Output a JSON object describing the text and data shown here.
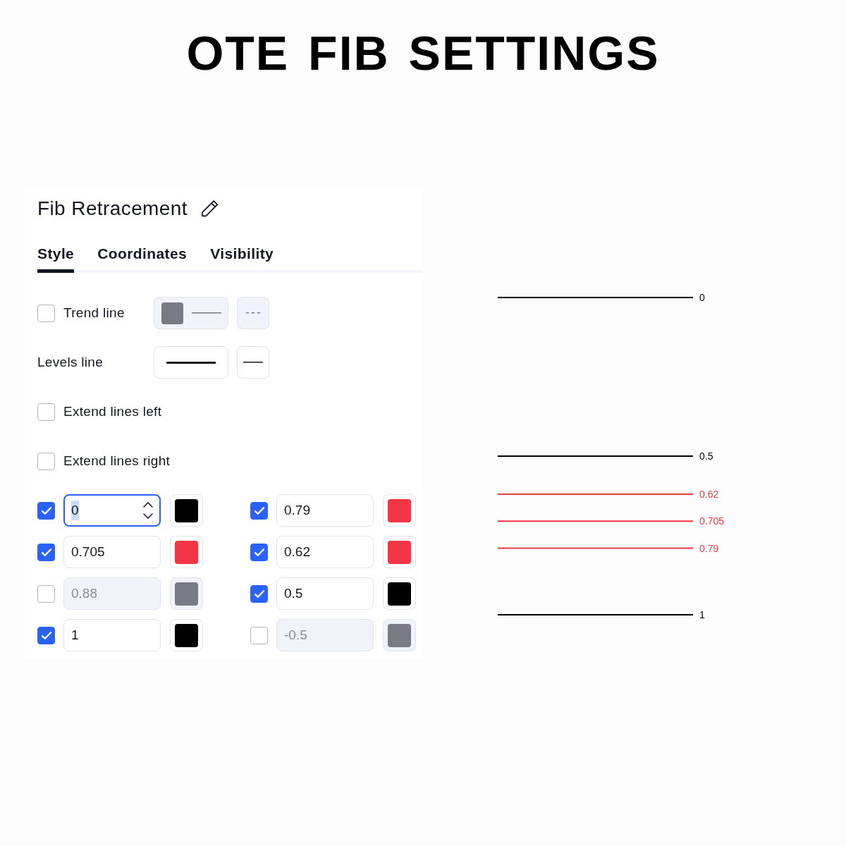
{
  "page_title": "OTE FIB SETTINGS",
  "settings": {
    "title": "Fib Retracement",
    "tabs": [
      {
        "label": "Style",
        "selected": true
      },
      {
        "label": "Coordinates",
        "selected": false
      },
      {
        "label": "Visibility",
        "selected": false
      }
    ],
    "rows": [
      {
        "kind": "line-toggle",
        "label": "Trend line",
        "checked": false
      },
      {
        "kind": "line",
        "label": "Levels line"
      },
      {
        "kind": "toggle",
        "label": "Extend lines left",
        "checked": false
      },
      {
        "kind": "toggle",
        "label": "Extend lines right",
        "checked": false
      }
    ],
    "levels": [
      {
        "value": "0",
        "checked": true,
        "focused": true,
        "color": "#000000"
      },
      {
        "value": "0.79",
        "checked": true,
        "focused": false,
        "color": "#f23645"
      },
      {
        "value": "0.705",
        "checked": true,
        "focused": false,
        "color": "#f23645"
      },
      {
        "value": "0.62",
        "checked": true,
        "focused": false,
        "color": "#f23645"
      },
      {
        "value": "0.88",
        "checked": false,
        "focused": false,
        "color": "#787b86"
      },
      {
        "value": "0.5",
        "checked": true,
        "focused": false,
        "color": "#000000"
      },
      {
        "value": "1",
        "checked": true,
        "focused": false,
        "color": "#000000"
      },
      {
        "value": "-0.5",
        "checked": false,
        "focused": false,
        "color": "#787b86"
      }
    ]
  },
  "preview": {
    "lines": [
      {
        "label": "0",
        "color": "#000000"
      },
      {
        "label": "0.5",
        "color": "#000000"
      },
      {
        "label": "0.62",
        "color": "#f23645"
      },
      {
        "label": "0.705",
        "color": "#f23645"
      },
      {
        "label": "0.79",
        "color": "#f23645"
      },
      {
        "label": "1",
        "color": "#000000"
      }
    ]
  }
}
